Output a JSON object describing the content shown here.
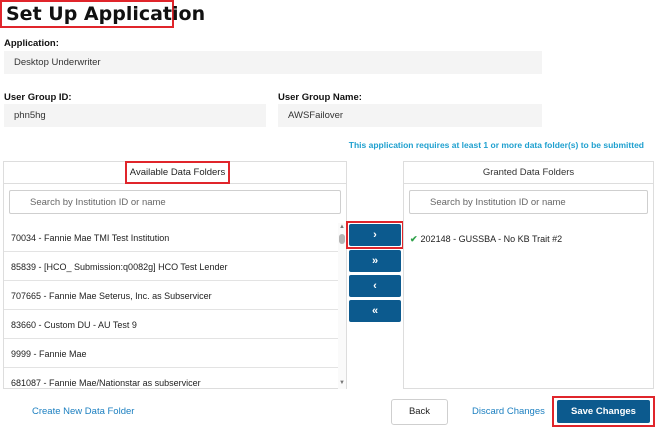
{
  "page": {
    "title": "Set Up Application"
  },
  "application": {
    "label": "Application:",
    "value": "Desktop Underwriter"
  },
  "user_group": {
    "id_label": "User Group ID:",
    "id_value": "phn5hg",
    "name_label": "User Group Name:",
    "name_value": "AWSFailover"
  },
  "notice": "This application requires at least 1 or more data folder(s) to be submitted",
  "available": {
    "header": "Available Data Folders",
    "search_placeholder": "Search by Institution ID or name",
    "items": [
      "70034 - Fannie Mae TMI Test Institution",
      "85839 - [HCO_ Submission:q0082g] HCO Test Lender",
      "707665 - Fannie Mae Seterus, Inc. as Subservicer",
      "83660 - Custom DU - AU Test 9",
      "9999 - Fannie Mae",
      "681087 - Fannie Mae/Nationstar as subservicer"
    ]
  },
  "transfer_buttons": {
    "move_one": "›",
    "move_all": "»",
    "remove_one": "‹",
    "remove_all": "«"
  },
  "granted": {
    "header": "Granted Data Folders",
    "search_placeholder": "Search by Institution ID or name",
    "items": [
      "202148 - GUSSBA - No KB Trait #2"
    ]
  },
  "footer": {
    "create_link": "Create New Data Folder",
    "back": "Back",
    "discard": "Discard Changes",
    "save": "Save Changes"
  },
  "colors": {
    "primary": "#0c5a8e",
    "highlight": "#e0252b",
    "notice": "#1fa0cf",
    "link": "#1b7fc0",
    "check": "#2fa14a"
  }
}
